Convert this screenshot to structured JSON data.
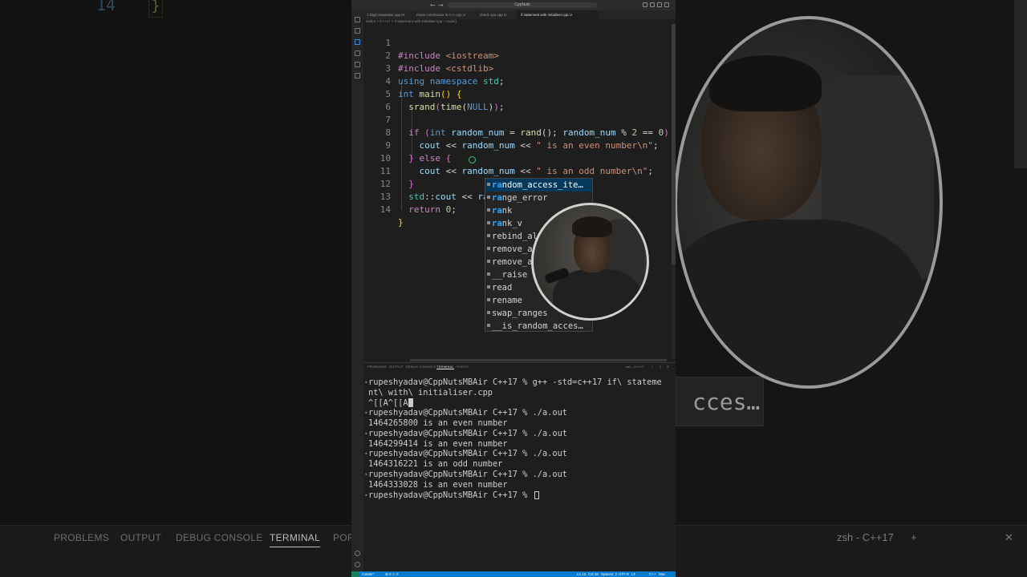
{
  "titlebar": {
    "search_text": "CppNuts"
  },
  "tabs": [
    {
      "label": "1 Digit Separator.cpp M",
      "active": false
    },
    {
      "label": "move constructor in c++.cpp U",
      "active": false
    },
    {
      "label": "check cpu.cpp U",
      "active": false
    },
    {
      "label": "if statement with initialiser.cpp U",
      "active": true
    }
  ],
  "breadcrumb": "initbot > C++17 > if statement with initialiser.cpp > main()",
  "editor": {
    "line_numbers": [
      "1",
      "2",
      "3",
      "4",
      "5",
      "6",
      "7",
      "8",
      "9",
      "10",
      "11",
      "12",
      "13",
      "14"
    ]
  },
  "suggestions": [
    {
      "hl": "ra",
      "rest": "ndom_access_ite…",
      "full": "random_access_ite…",
      "selected": true
    },
    {
      "hl": "ra",
      "rest": "nge_error",
      "full": "range_error",
      "selected": false
    },
    {
      "hl": "ra",
      "rest": "nk",
      "full": "rank",
      "selected": false
    },
    {
      "hl": "ra",
      "rest": "nk_v",
      "full": "rank_v",
      "selected": false
    },
    {
      "hl": "",
      "rest": "rebind_al",
      "full": "rebind_al",
      "selected": false
    },
    {
      "hl": "",
      "rest": "remove_a",
      "full": "remove_a",
      "selected": false
    },
    {
      "hl": "",
      "rest": "remove_a",
      "full": "remove_a",
      "selected": false
    },
    {
      "hl": "",
      "rest": "__raise",
      "full": "__raise",
      "selected": false
    },
    {
      "hl": "",
      "rest": "read",
      "full": "read",
      "selected": false
    },
    {
      "hl": "",
      "rest": "rename",
      "full": "rename",
      "selected": false
    },
    {
      "hl": "",
      "rest": "swap_ranges",
      "full": "swap_ranges",
      "selected": false
    },
    {
      "hl": "",
      "rest": "__is_random_acces…",
      "full": "__is_random_acces…",
      "selected": false
    }
  ],
  "panel": {
    "tabs": [
      "PROBLEMS",
      "OUTPUT",
      "DEBUG CONSOLE",
      "TERMINAL",
      "PORTS"
    ],
    "active_tab": "TERMINAL",
    "shell_label": "zsh - C++17"
  },
  "terminal": {
    "lines": [
      "rupeshyadav@CppNutsMBAir C++17 % g++ -std=c++17 if\\ stateme",
      "nt\\ with\\ initialiser.cpp",
      "^[[A^[[A",
      "rupeshyadav@CppNutsMBAir C++17 % ./a.out",
      "1464265800 is an even number",
      "rupeshyadav@CppNutsMBAir C++17 % ./a.out",
      "1464299414 is an even number",
      "rupeshyadav@CppNutsMBAir C++17 % ./a.out",
      "1464316221 is an odd number",
      "rupeshyadav@CppNutsMBAir C++17 % ./a.out",
      "1464333028 is an even number",
      "rupeshyadav@CppNutsMBAir C++17 % "
    ]
  },
  "statusbar": {
    "branch": "master*",
    "problems": "⊗ 0 ⚠ 0",
    "position": "Ln 12, Col 18",
    "spaces": "Spaces: 2",
    "encoding": "UTF-8",
    "eol": "LF",
    "language": "C++",
    "platform": "Mac"
  },
  "background": {
    "ghost_line_number": "14",
    "ghost_brace": "}",
    "ghost_popup_text": "cces…",
    "ghost_tabs": [
      "PROBLEMS",
      "OUTPUT",
      "DEBUG CONSOLE",
      "TERMINAL",
      "POR"
    ],
    "ghost_shell": "zsh - C++17"
  },
  "colors": {
    "accent": "#007acc",
    "suggest_highlight": "#2aaaff",
    "selected_suggestion": "#04395e"
  }
}
